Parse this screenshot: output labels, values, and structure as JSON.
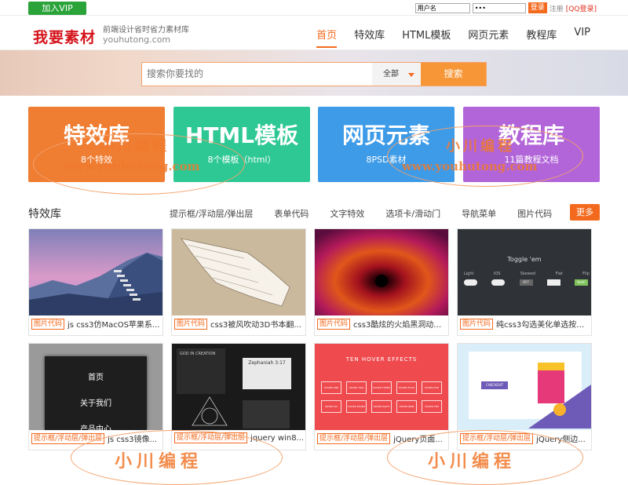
{
  "topbar": {
    "vip_label": "加入VIP",
    "username_value": "用户名",
    "password_value": "•••",
    "login_label": "登录",
    "register_label": "注册",
    "qq_label": "[QQ登录]"
  },
  "header": {
    "logo": "我要素材",
    "slogan": "前端设计省时省力素材库",
    "domain": "youhutong.com",
    "nav": [
      "首页",
      "特效库",
      "HTML模板",
      "网页元素",
      "教程库",
      "VIP"
    ]
  },
  "search": {
    "placeholder": "搜索你要找的",
    "select_value": "全部",
    "button_label": "搜索"
  },
  "categories": [
    {
      "title": "特效库",
      "sub": "8个特效",
      "color": "#ef7d32"
    },
    {
      "title": "HTML模板",
      "sub": "8个模板（html）",
      "color": "#2ec894"
    },
    {
      "title": "网页元素",
      "sub": "8PSD素材",
      "color": "#3d9be8"
    },
    {
      "title": "教程库",
      "sub": "11篇教程文档",
      "color": "#b264d9"
    }
  ],
  "section": {
    "title": "特效库",
    "subnav": [
      "提示框/浮动层/弹出层",
      "表单代码",
      "文字特效",
      "选项卡/滑动门",
      "导航菜单",
      "图片代码"
    ],
    "more_label": "更多"
  },
  "cards": [
    {
      "tag": "图片代码",
      "text": "js css3仿MacOS苹果系..."
    },
    {
      "tag": "图片代码",
      "text": "css3被风吹动3D书本翻..."
    },
    {
      "tag": "图片代码",
      "text": "css3酷炫的火焰黑洞动画..."
    },
    {
      "tag": "图片代码",
      "text": "纯css3勾选美化单选按钮..."
    },
    {
      "tag": "提示框/浮动层/弹出层",
      "text": "js css3镜像..."
    },
    {
      "tag": "提示框/浮动层/弹出层",
      "text": "jquery win8..."
    },
    {
      "tag": "提示框/浮动层/弹出层",
      "text": "jQuery页面..."
    },
    {
      "tag": "提示框/浮动层/弹出层",
      "text": "jQuery侧边..."
    }
  ],
  "thumbs": {
    "menu_items": [
      "首页",
      "关于我们",
      "产品中心"
    ],
    "toggle_title": "Toggle 'em",
    "toggle_labels": [
      "Light",
      "iOS",
      "Skewed",
      "Flat",
      "Flip"
    ],
    "toggle_states": [
      "",
      "",
      "OFF",
      "",
      "Yeah!"
    ],
    "win8_title": "Zephaniah 3:17",
    "win8_tile_text": "GOD IN CREATION",
    "hover_title": "TEN HOVER EFFECTS",
    "hover_items": [
      "HOVER ONE",
      "HOVER TWO",
      "HOVER THREE",
      "HOVER FOUR",
      "HOVER FIVE",
      "HOVER SIX",
      "HOVER SEVEN",
      "HOVER EIGHT",
      "HOVER NINE",
      "HOVER TEN"
    ],
    "checkout_label": "CHECKOUT"
  },
  "watermarks": {
    "cn": "小川编程",
    "url": "www.youhutong.com"
  }
}
